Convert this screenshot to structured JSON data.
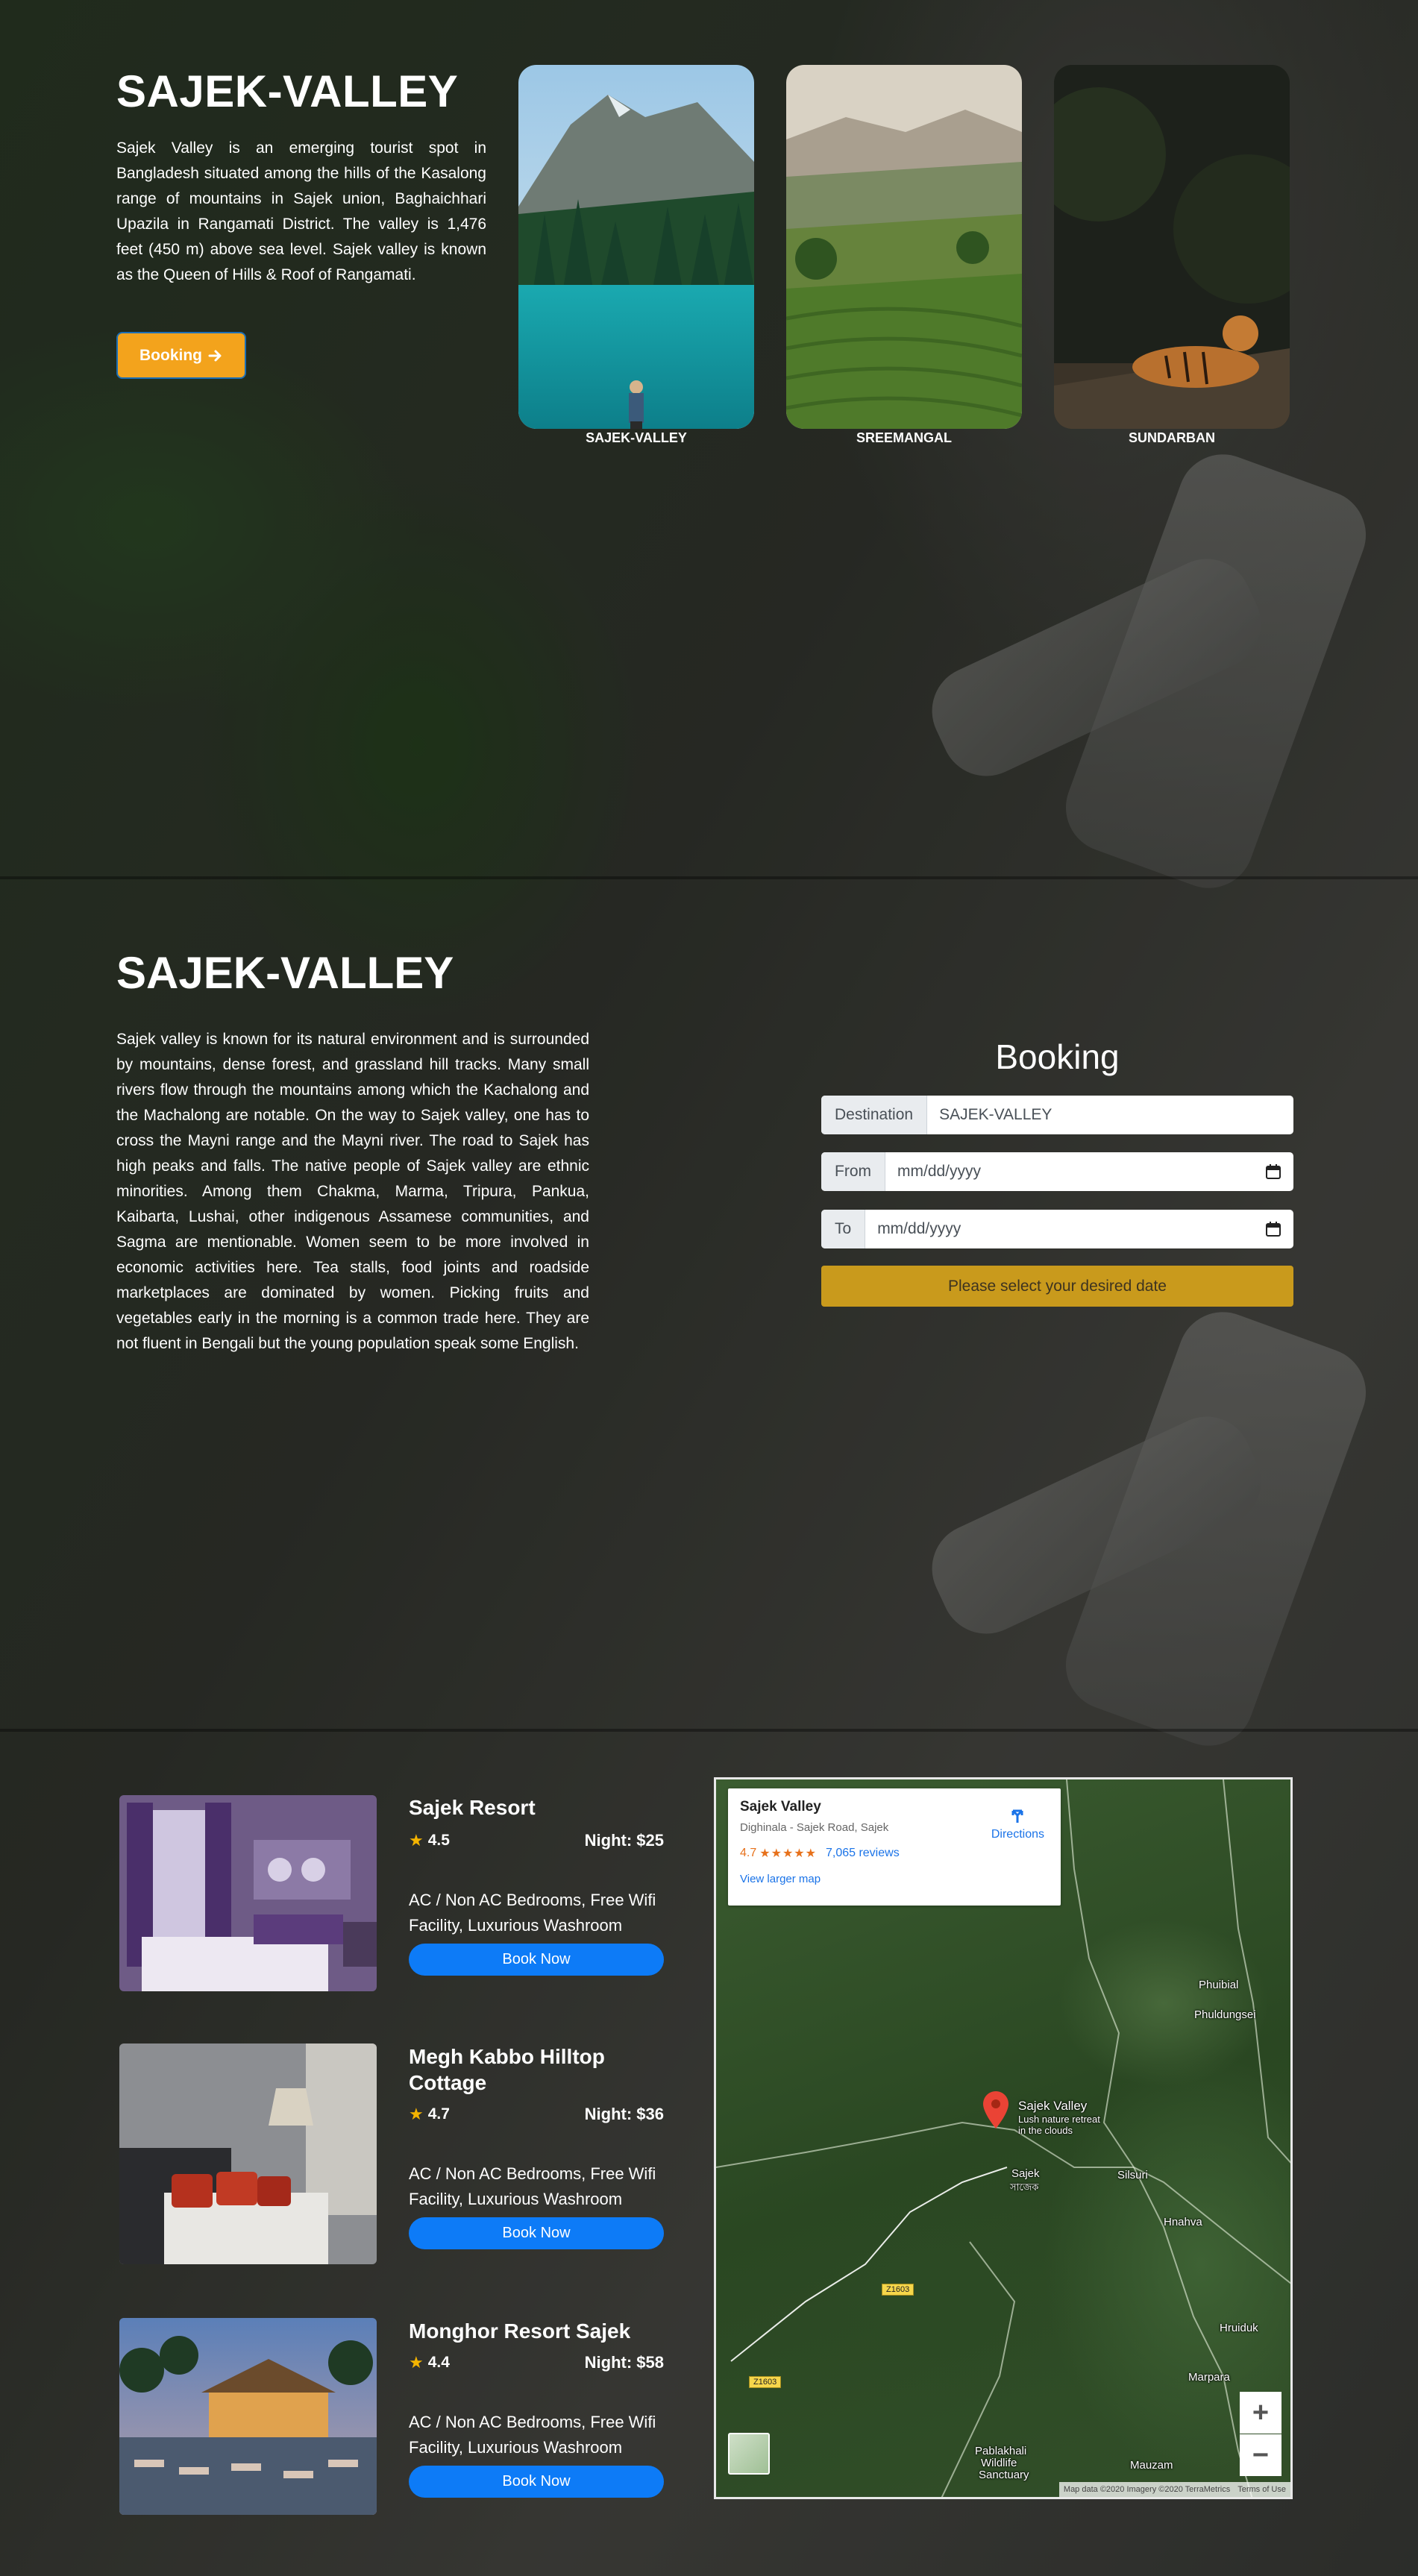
{
  "hero": {
    "title": "SAJEK-VALLEY",
    "description": "Sajek Valley is an emerging tourist spot in Bangladesh situated among the hills of the Kasalong range of mountains in Sajek union, Baghaichhari Upazila in Rangamati District. The valley is 1,476 feet (450 m) above sea level. Sajek valley is known as the Queen of Hills & Roof of Rangamati.",
    "booking_label": "Booking",
    "cards": [
      {
        "label": "SAJEK-VALLEY"
      },
      {
        "label": "SREEMANGAL"
      },
      {
        "label": "SUNDARBAN"
      }
    ]
  },
  "details": {
    "title": "SAJEK-VALLEY",
    "description": "Sajek valley is known for its natural environment and is surrounded by mountains, dense forest, and grassland hill tracks. Many small rivers flow through the mountains among which the Kachalong and the Machalong are notable. On the way to Sajek valley, one has to cross the Mayni range and the Mayni river. The road to Sajek has high peaks and falls. The native people of Sajek valley are ethnic minorities. Among them Chakma, Marma, Tripura, Pankua, Kaibarta, Lushai, other indigenous Assamese communities, and Sagma are mentionable. Women seem to be more involved in economic activities here. Tea stalls, food joints and roadside marketplaces are dominated by women. Picking fruits and vegetables early in the morning is a common trade here. They are not fluent in Bengali but the young population speak some English."
  },
  "booking_form": {
    "title": "Booking",
    "destination_label": "Destination",
    "destination_value": "SAJEK-VALLEY",
    "from_label": "From",
    "from_placeholder": "mm/dd/yyyy",
    "to_label": "To",
    "to_placeholder": "mm/dd/yyyy",
    "submit_label": "Please select your desired date"
  },
  "hotels": [
    {
      "name": "Sajek Resort",
      "rating": "4.5",
      "price": "Night: $25",
      "description": "AC / Non AC Bedrooms, Free Wifi Facility, Luxurious Washroom",
      "button": "Book Now"
    },
    {
      "name": "Megh Kabbo Hilltop Cottage",
      "rating": "4.7",
      "price": "Night: $36",
      "description": "AC / Non AC Bedrooms, Free Wifi Facility, Luxurious Washroom",
      "button": "Book Now"
    },
    {
      "name": "Monghor Resort Sajek",
      "rating": "4.4",
      "price": "Night: $58",
      "description": "AC / Non AC Bedrooms, Free Wifi Facility, Luxurious Washroom",
      "button": "Book Now"
    }
  ],
  "map": {
    "place_title": "Sajek Valley",
    "address": "Dighinala - Sajek Road, Sajek",
    "rating": "4.7",
    "stars": "★★★★★",
    "reviews": "7,065 reviews",
    "larger_map": "View larger map",
    "directions": "Directions",
    "pin_title": "Sajek Valley",
    "pin_sub1": "Lush nature retreat",
    "pin_sub2": "in the clouds",
    "labels": {
      "sajek": "Sajek",
      "sajek_local": "সাজেক",
      "phuibial": "Phuibial",
      "phuldungsei": "Phuldungsei",
      "silsuri": "Silsuri",
      "hnahva": "Hnahva",
      "hruiduk": "Hruiduk",
      "marpara": "Marpara",
      "mauzam": "Mauzam",
      "pablakhali1": "Pablakhali",
      "pablakhali2": "Wildlife",
      "pablakhali3": "Sanctuary",
      "road1": "Z1603",
      "road2": "Z1603"
    },
    "zoom_in": "+",
    "zoom_out": "−",
    "attribution": "Map data ©2020 Imagery ©2020 TerraMetrics",
    "terms": "Terms of Use"
  },
  "colors": {
    "booking_btn": "#f3a31c",
    "submit_btn": "#c99a1c",
    "book_now": "#0d7bf7"
  }
}
